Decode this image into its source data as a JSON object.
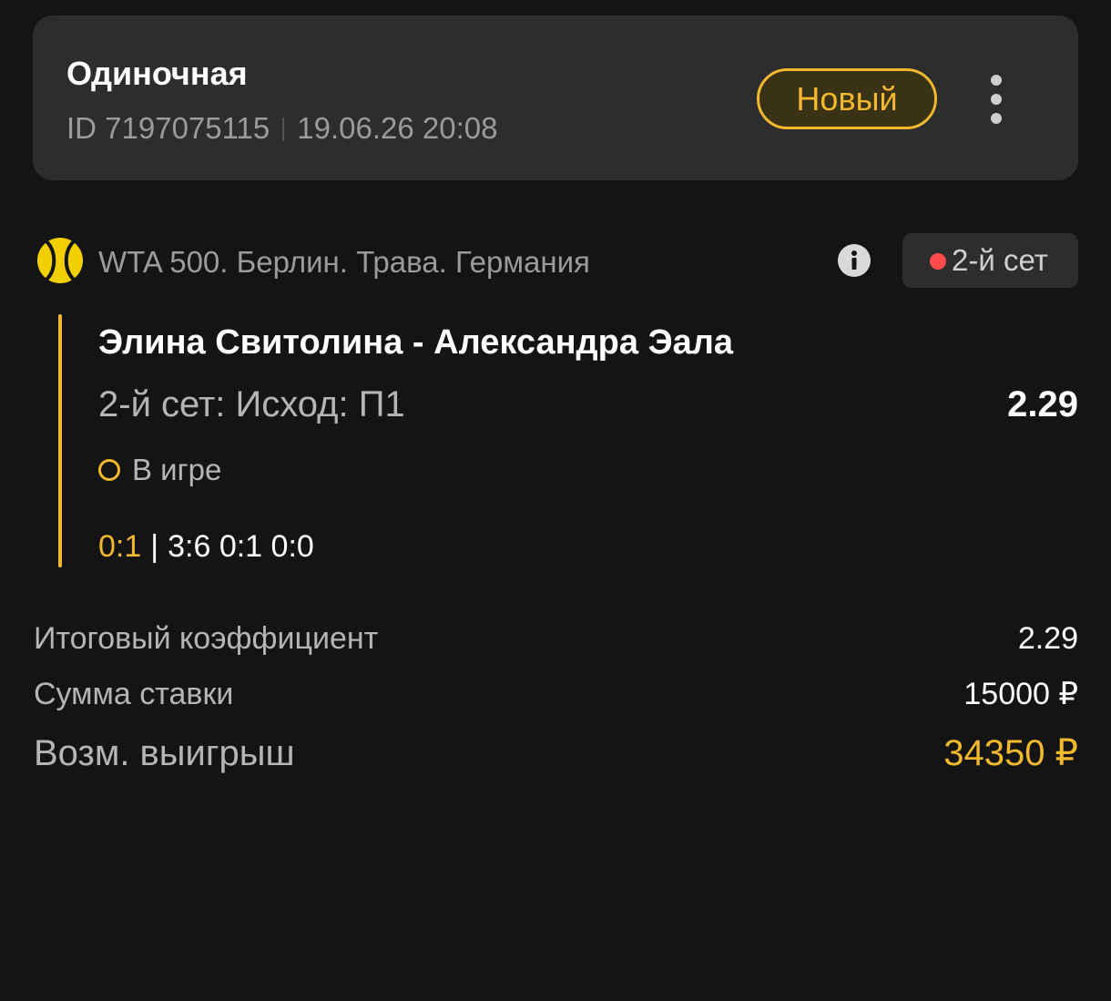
{
  "header": {
    "bet_type": "Одиночная",
    "bet_id": "ID 7197075115",
    "datetime": "19.06.26 20:08",
    "status": "Новый",
    "menu_icon": "more-vertical-icon"
  },
  "event": {
    "sport_icon": "tennis-ball-icon",
    "league": "WTA 500. Берлин. Трава. Германия",
    "info_icon": "info-icon",
    "live_period": "2-й сет",
    "match": "Элина Свитолина - Александра Эала",
    "market": "2-й сет: Исход: П1",
    "odds": "2.29",
    "state": "В игре",
    "score_sets": "0:1",
    "score_separator": "|",
    "score_games": "3:6 0:1 0:0"
  },
  "summary": {
    "total_odds_label": "Итоговый коэффициент",
    "total_odds_value": "2.29",
    "stake_label": "Сумма ставки",
    "stake_value": "15000 ₽",
    "payout_label": "Возм. выигрыш",
    "payout_value": "34350 ₽"
  },
  "colors": {
    "background": "#141414",
    "card": "#2d2d2d",
    "accent": "#f2b82e",
    "live": "#ff4b4b",
    "muted_text": "#9b9b9b"
  }
}
